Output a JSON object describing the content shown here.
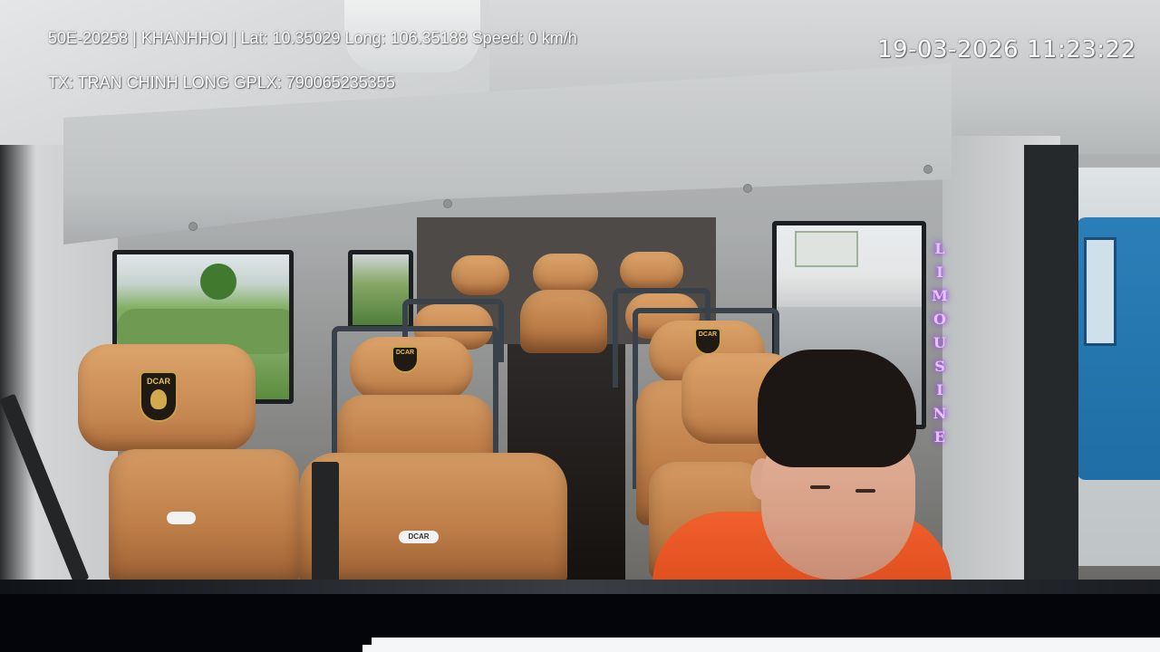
{
  "osd": {
    "vehicle_line": "50E-20258 | KHANHHOI | Lat: 10.35029 Long: 106.35188 Speed: 0 km/h",
    "driver_line": "TX: TRAN CHINH LONG GPLX: 790065235355",
    "timestamp": "19-03-2026 11:23:22"
  },
  "scene": {
    "window_sign_letters": [
      "L",
      "I",
      "M",
      "O",
      "U",
      "S",
      "I",
      "N",
      "E"
    ],
    "seat_brand": "DCAR"
  },
  "colors": {
    "osd_text": "#ffffff",
    "seat_leather": "#c07f49",
    "driver_shirt": "#e04f1f",
    "sign_glow": "#b25bff"
  }
}
